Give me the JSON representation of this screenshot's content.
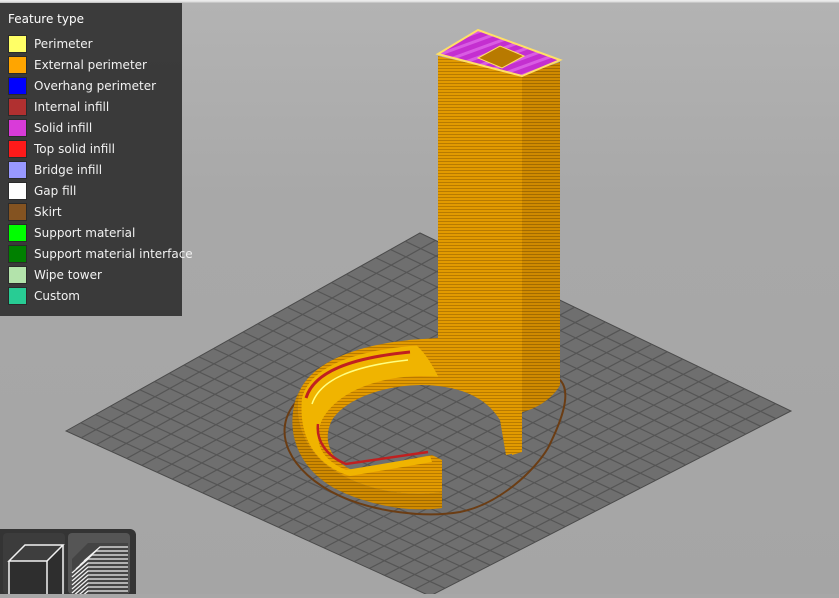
{
  "legend": {
    "title": "Feature type",
    "items": [
      {
        "label": "Perimeter",
        "color": "#ffff66"
      },
      {
        "label": "External perimeter",
        "color": "#ffa500"
      },
      {
        "label": "Overhang perimeter",
        "color": "#0000ff"
      },
      {
        "label": "Internal infill",
        "color": "#b03030"
      },
      {
        "label": "Solid infill",
        "color": "#d93bd9"
      },
      {
        "label": "Top solid infill",
        "color": "#ff1a1a"
      },
      {
        "label": "Bridge infill",
        "color": "#9999ff"
      },
      {
        "label": "Gap fill",
        "color": "#ffffff"
      },
      {
        "label": "Skirt",
        "color": "#845321"
      },
      {
        "label": "Support material",
        "color": "#00ff00"
      },
      {
        "label": "Support material interface",
        "color": "#008000"
      },
      {
        "label": "Wipe tower",
        "color": "#b3e3ab"
      },
      {
        "label": "Custom",
        "color": "#28cc94"
      }
    ]
  },
  "colors": {
    "background": "#a7a7a7",
    "bed_grid": "#6e6e6e",
    "bed_lines": "#4a4a4a",
    "model": "#e39a00",
    "skirt": "#845321"
  },
  "view_toolbar": {
    "buttons": [
      {
        "name": "3d-view",
        "icon": "cube-icon"
      },
      {
        "name": "preview",
        "icon": "layers-icon"
      }
    ]
  }
}
